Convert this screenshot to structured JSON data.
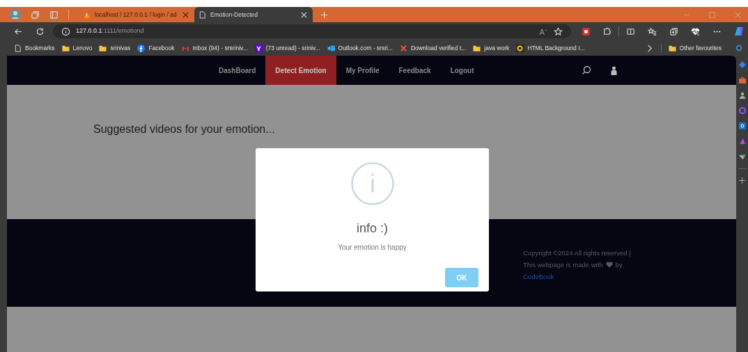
{
  "browser": {
    "tabs": [
      {
        "label": "localhost / 127.0.0.1 / login / ad",
        "selected": false,
        "kind": "db"
      },
      {
        "label": "Emotion-Detected",
        "selected": true,
        "kind": "page"
      }
    ],
    "address": {
      "host": "127.0.0.1",
      "path": ":1111/emotiond"
    },
    "bookmarks": [
      {
        "label": "Bookmarks",
        "kind": "page"
      },
      {
        "label": "Lenovo",
        "kind": "folder"
      },
      {
        "label": "srinivas",
        "kind": "folder"
      },
      {
        "label": "Facebook",
        "kind": "facebook"
      },
      {
        "label": "Inbox (94) - srsriniv...",
        "kind": "mail"
      },
      {
        "label": "(73 unread) - sriniv...",
        "kind": "yahoo"
      },
      {
        "label": "Outlook.com - srsri...",
        "kind": "outlook"
      },
      {
        "label": "Download verified t...",
        "kind": "cross"
      },
      {
        "label": "java work",
        "kind": "folder"
      },
      {
        "label": "HTML Background I...",
        "kind": "target"
      }
    ],
    "other_favourites": "Other favourites"
  },
  "nav": {
    "items": [
      {
        "label": "DashBoard",
        "selected": false
      },
      {
        "label": "Detect Emotion",
        "selected": true
      },
      {
        "label": "My Profile",
        "selected": false
      },
      {
        "label": "Feedback",
        "selected": false
      },
      {
        "label": "Logout",
        "selected": false
      }
    ]
  },
  "heading": "Suggested videos for your emotion...",
  "footer": {
    "line_1": "Copyright ©2024 All rights reserved |",
    "line_2_before": "This webpage is made with",
    "line_2_after": "by",
    "link": "CodeBook"
  },
  "modal": {
    "title": "info :)",
    "message": "Your emotion is happy",
    "button": "OK"
  }
}
